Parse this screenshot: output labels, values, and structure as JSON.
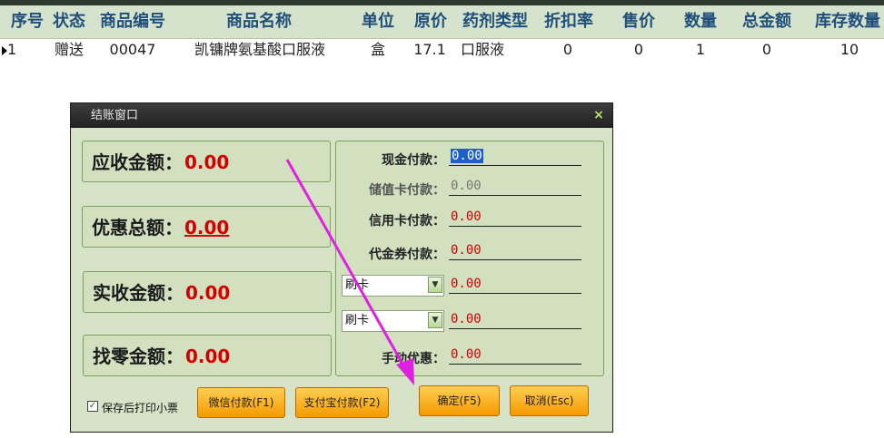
{
  "grid": {
    "headers": [
      "序号",
      "状态",
      "商品编号",
      "商品名称",
      "单位",
      "原价",
      "药剂类型",
      "折扣率",
      "售价",
      "数量",
      "总金额",
      "库存数量"
    ],
    "row": [
      "1",
      "赠送",
      "00047",
      "凯镛牌氨基酸口服液",
      "盒",
      "17.1",
      "口服液",
      "0",
      "0",
      "1",
      "0",
      "10"
    ]
  },
  "dialog": {
    "title": "结账窗口",
    "close_glyph": "×",
    "summary": {
      "receivable_label": "应收金额：",
      "receivable_value": "0.00",
      "discount_label": "优惠总额：",
      "discount_value": "0.00",
      "received_label": "实收金额：",
      "received_value": "0.00",
      "change_label": "找零金额：",
      "change_value": "0.00"
    },
    "payments": {
      "cash_label": "现金付款：",
      "cash_value": "0.00",
      "stored_card_label": "储值卡付款：",
      "stored_card_value": "0.00",
      "credit_card_label": "信用卡付款：",
      "credit_card_value": "0.00",
      "voucher_label": "代金券付款：",
      "voucher_value": "0.00",
      "combo1_value": "刷卡",
      "combo1_amount": "0.00",
      "combo2_value": "刷卡",
      "combo2_amount": "0.00",
      "manual_discount_label": "手动优惠：",
      "manual_discount_value": "0.00"
    },
    "print_receipt_label": "保存后打印小票",
    "print_receipt_checked": true,
    "buttons": {
      "wechat": "微信付款(F1)",
      "alipay": "支付宝付款(F2)",
      "confirm": "确定(F5)",
      "cancel": "取消(Esc)"
    }
  },
  "colors": {
    "accent_red": "#d40000",
    "annotation_arrow": "#e020e0",
    "button_orange": "#f49a00"
  }
}
